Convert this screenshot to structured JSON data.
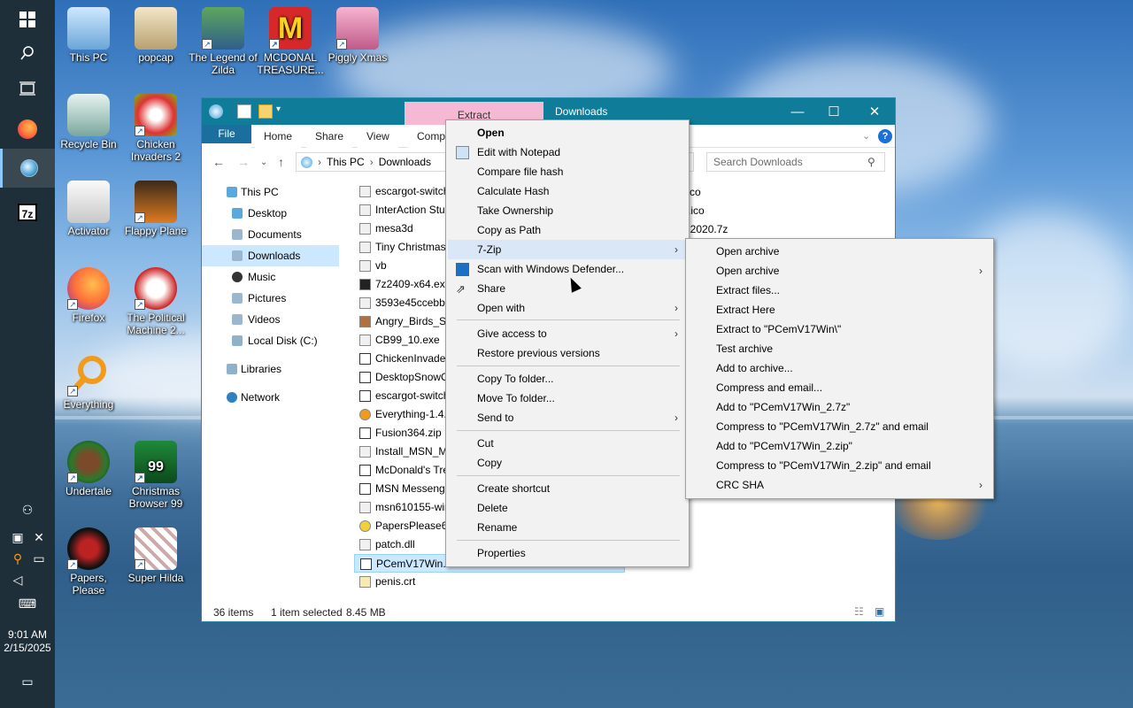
{
  "taskbar": {
    "clock_time": "9:01 AM",
    "clock_date": "2/15/2025",
    "start_icon": "windows-icon",
    "search_icon": "search-icon",
    "taskview_icon": "task-view-icon"
  },
  "desktop_icons": [
    {
      "label": "This PC"
    },
    {
      "label": "popcap"
    },
    {
      "label": "The Legend of Zilda"
    },
    {
      "label": "MCDONAL TREASURE..."
    },
    {
      "label": "Piggly Xmas"
    },
    {
      "label": "Recycle Bin"
    },
    {
      "label": "Chicken Invaders 2"
    },
    {
      "label": "Activator"
    },
    {
      "label": "Flappy Plane"
    },
    {
      "label": "Firefox"
    },
    {
      "label": "The Political Machine 2..."
    },
    {
      "label": "Everything"
    },
    {
      "label": "Undertale"
    },
    {
      "label": "Christmas Browser 99"
    },
    {
      "label": "Papers, Please"
    },
    {
      "label": "Super Hilda"
    }
  ],
  "explorer": {
    "extract_tab": "Extract",
    "title": "Downloads",
    "ribbon_tabs": [
      "File",
      "Home",
      "Share",
      "View",
      "Compr"
    ],
    "breadcrumb": [
      "This PC",
      "Downloads"
    ],
    "search_placeholder": "Search Downloads",
    "nav": [
      {
        "label": "This PC"
      },
      {
        "label": "Desktop"
      },
      {
        "label": "Documents"
      },
      {
        "label": "Downloads"
      },
      {
        "label": "Music"
      },
      {
        "label": "Pictures"
      },
      {
        "label": "Videos"
      },
      {
        "label": "Local Disk (C:)"
      },
      {
        "label": "Libraries"
      },
      {
        "label": "Network"
      }
    ],
    "files": [
      "escargot-switch",
      "InterAction Stu",
      "mesa3d",
      "Tiny Christmas",
      "vb",
      "7z2409-x64.exe",
      "3593e45ccebba",
      "Angry_Birds_Se",
      "CB99_10.exe",
      "ChickenInvader",
      "DesktopSnowO",
      "escargot-switch",
      "Everything-1.4.",
      "Fusion364.zip",
      "Install_MSN_M",
      "McDonald's Tre",
      "MSN Messenge",
      "msn610155-win",
      "PapersPlease64",
      "patch.dll",
      "PCemV17Win.z",
      "penis.crt"
    ],
    "right_col": [
      "co",
      ".ico",
      "l2020.7z"
    ],
    "status_count": "36 items",
    "status_selected": "1 item selected",
    "status_size": "8.45 MB"
  },
  "context_menu": {
    "items": [
      "Open",
      "Edit with Notepad",
      "Compare file hash",
      "Calculate Hash",
      "Take Ownership",
      "Copy as Path",
      "7-Zip",
      "Scan with Windows Defender...",
      "Share",
      "Open with",
      "Give access to",
      "Restore previous versions",
      "Copy To folder...",
      "Move To folder...",
      "Send to",
      "Cut",
      "Copy",
      "Create shortcut",
      "Delete",
      "Rename",
      "Properties"
    ]
  },
  "submenu_7zip": {
    "items": [
      "Open archive",
      "Open archive",
      "Extract files...",
      "Extract Here",
      "Extract to \"PCemV17Win\\\"",
      "Test archive",
      "Add to archive...",
      "Compress and email...",
      "Add to \"PCemV17Win_2.7z\"",
      "Compress to \"PCemV17Win_2.7z\" and email",
      "Add to \"PCemV17Win_2.zip\"",
      "Compress to \"PCemV17Win_2.zip\" and email",
      "CRC SHA"
    ]
  },
  "colors": {
    "title_bar": "#0f7c99",
    "extract_tab": "#f6b9d4",
    "selection": "#cce8ff",
    "menu_bg": "#f2f2f2",
    "taskbar": "#1f2f3a"
  }
}
